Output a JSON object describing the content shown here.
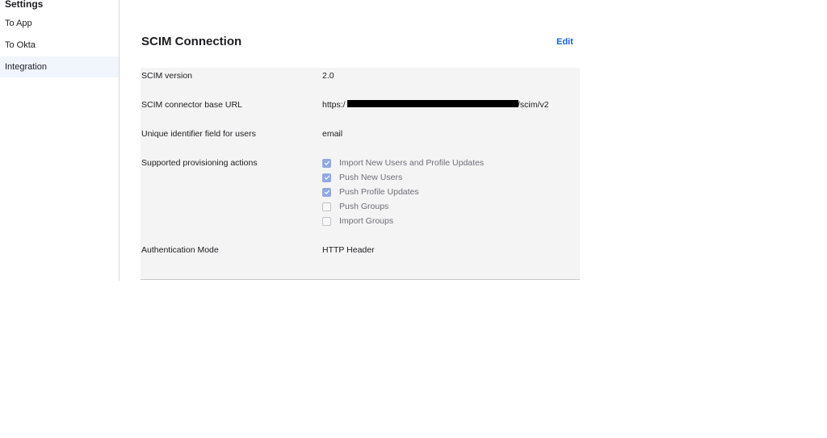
{
  "sidebar": {
    "title": "Settings",
    "items": [
      {
        "label": "To App",
        "active": false
      },
      {
        "label": "To Okta",
        "active": false
      },
      {
        "label": "Integration",
        "active": true
      }
    ]
  },
  "section": {
    "title": "SCIM Connection",
    "edit_label": "Edit"
  },
  "fields": {
    "scim_version": {
      "label": "SCIM version",
      "value": "2.0"
    },
    "base_url": {
      "label": "SCIM connector base URL",
      "prefix": "https:/",
      "suffix": "/scim/v2"
    },
    "unique_id": {
      "label": "Unique identifier field for users",
      "value": "email"
    },
    "provisioning": {
      "label": "Supported provisioning actions",
      "actions": [
        {
          "label": "Import New Users and Profile Updates",
          "checked": true
        },
        {
          "label": "Push New Users",
          "checked": true
        },
        {
          "label": "Push Profile Updates",
          "checked": true
        },
        {
          "label": "Push Groups",
          "checked": false
        },
        {
          "label": "Import Groups",
          "checked": false
        }
      ]
    },
    "auth_mode": {
      "label": "Authentication Mode",
      "value": "HTTP Header"
    }
  },
  "colors": {
    "accent": "#1662dd",
    "checkbox_checked": "#92a8e3",
    "panel_bg": "#f4f4f4",
    "active_item_bg": "#f1f5fc"
  }
}
